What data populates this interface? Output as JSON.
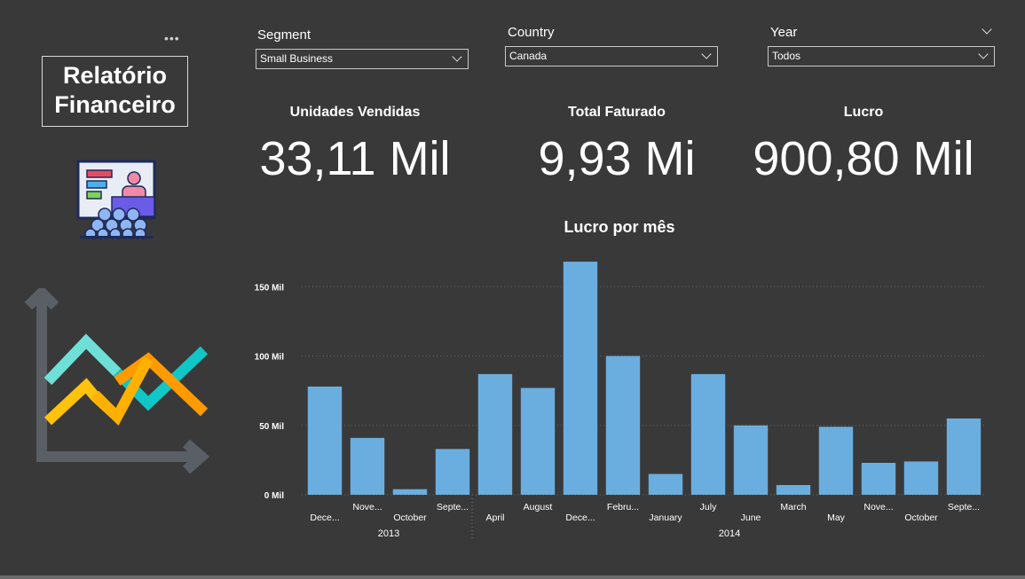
{
  "header": {
    "title_line1": "Relatório",
    "title_line2": "Financeiro",
    "more_icon": "ellipsis-icon"
  },
  "filters": {
    "segment": {
      "label": "Segment",
      "value": "Small Business"
    },
    "country": {
      "label": "Country",
      "value": "Canada"
    },
    "year": {
      "label": "Year",
      "value": "Todos"
    }
  },
  "kpis": {
    "units": {
      "title": "Unidades Vendidas",
      "value": "33,11 Mil"
    },
    "revenue": {
      "title": "Total Faturado",
      "value": "9,93 Mi"
    },
    "profit": {
      "title": "Lucro",
      "value": "900,80 Mil"
    }
  },
  "colors": {
    "background": "#393939",
    "bar": "#6aaee0",
    "gridline": "#666666"
  },
  "chart_data": {
    "type": "bar",
    "title": "Lucro por mês",
    "categories": [
      "Dece...",
      "Nove...",
      "October",
      "Septe...",
      "April",
      "August",
      "Dece...",
      "Febru...",
      "January",
      "July",
      "June",
      "March",
      "May",
      "Nove...",
      "October",
      "Septe..."
    ],
    "groups": [
      {
        "label": "2013",
        "count": 4
      },
      {
        "label": "2014",
        "count": 12
      }
    ],
    "values": [
      78,
      41,
      4,
      33,
      87,
      77,
      168,
      100,
      15,
      87,
      50,
      7,
      49,
      23,
      24,
      55
    ],
    "yticks": [
      "0 Mil",
      "50 Mil",
      "100 Mil",
      "150 Mil"
    ],
    "ylim": [
      0,
      170
    ],
    "grid": true
  }
}
